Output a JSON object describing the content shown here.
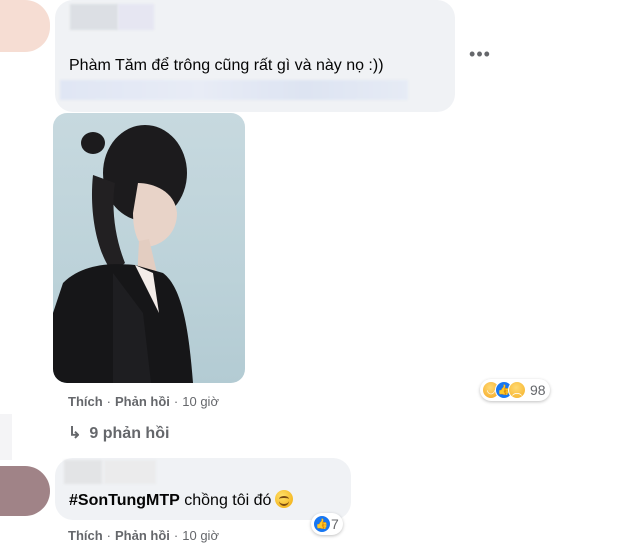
{
  "comments": [
    {
      "text": "Phàm Tăm để trông cũng rất gì và này nọ :))",
      "actions": {
        "like": "Thích",
        "reply": "Phản hồi",
        "time": "10 giờ"
      },
      "reactions": {
        "icons": [
          "haha-icon",
          "like-icon",
          "sad-icon"
        ],
        "count": "98"
      },
      "replies_label": "9 phản hồi"
    },
    {
      "hashtag": "#SonTungMTP",
      "text": "chồng tôi đó",
      "emoji": "smiling-face-icon",
      "actions": {
        "like": "Thích",
        "reply": "Phản hồi",
        "time": "10 giờ"
      },
      "reactions": {
        "icons": [
          "like-icon"
        ],
        "count": "7"
      }
    }
  ],
  "more_options_glyph": "•••",
  "colors": {
    "bubble": "#f0f2f5",
    "secondary_text": "#65676b",
    "like_blue": "#1877f2"
  }
}
